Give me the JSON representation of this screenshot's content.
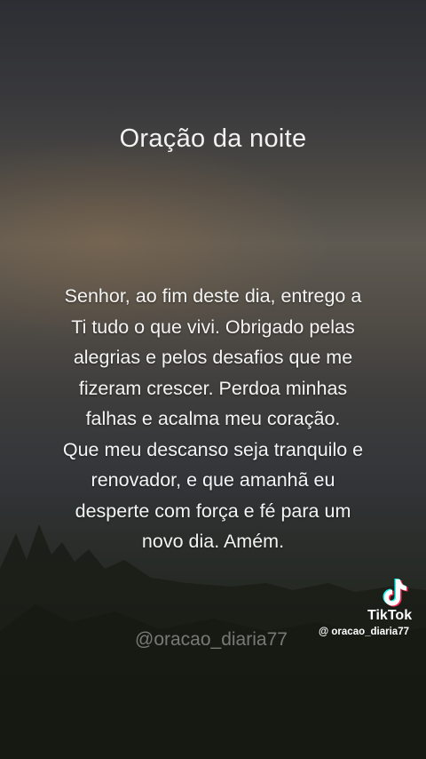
{
  "title": "Oração da noite",
  "prayer_lines": [
    "Senhor, ao fim deste dia, entrego a",
    "Ti tudo o que vivi. Obrigado pelas",
    "alegrias e pelos desafios que me",
    "fizeram crescer. Perdoa minhas",
    "falhas e acalma meu coração.",
    "Que meu descanso seja tranquilo e",
    "renovador, e que amanhã eu",
    "desperte com força e fé para um",
    "novo dia. Amém."
  ],
  "watermark": "@oracao_diaria77",
  "tiktok": {
    "brand": "TikTok",
    "username": "@ oracao_diaria77",
    "logo_icon": "tiktok-note-icon",
    "colors": {
      "cyan": "#25f4ee",
      "red": "#fe2c55",
      "white": "#ffffff"
    }
  }
}
